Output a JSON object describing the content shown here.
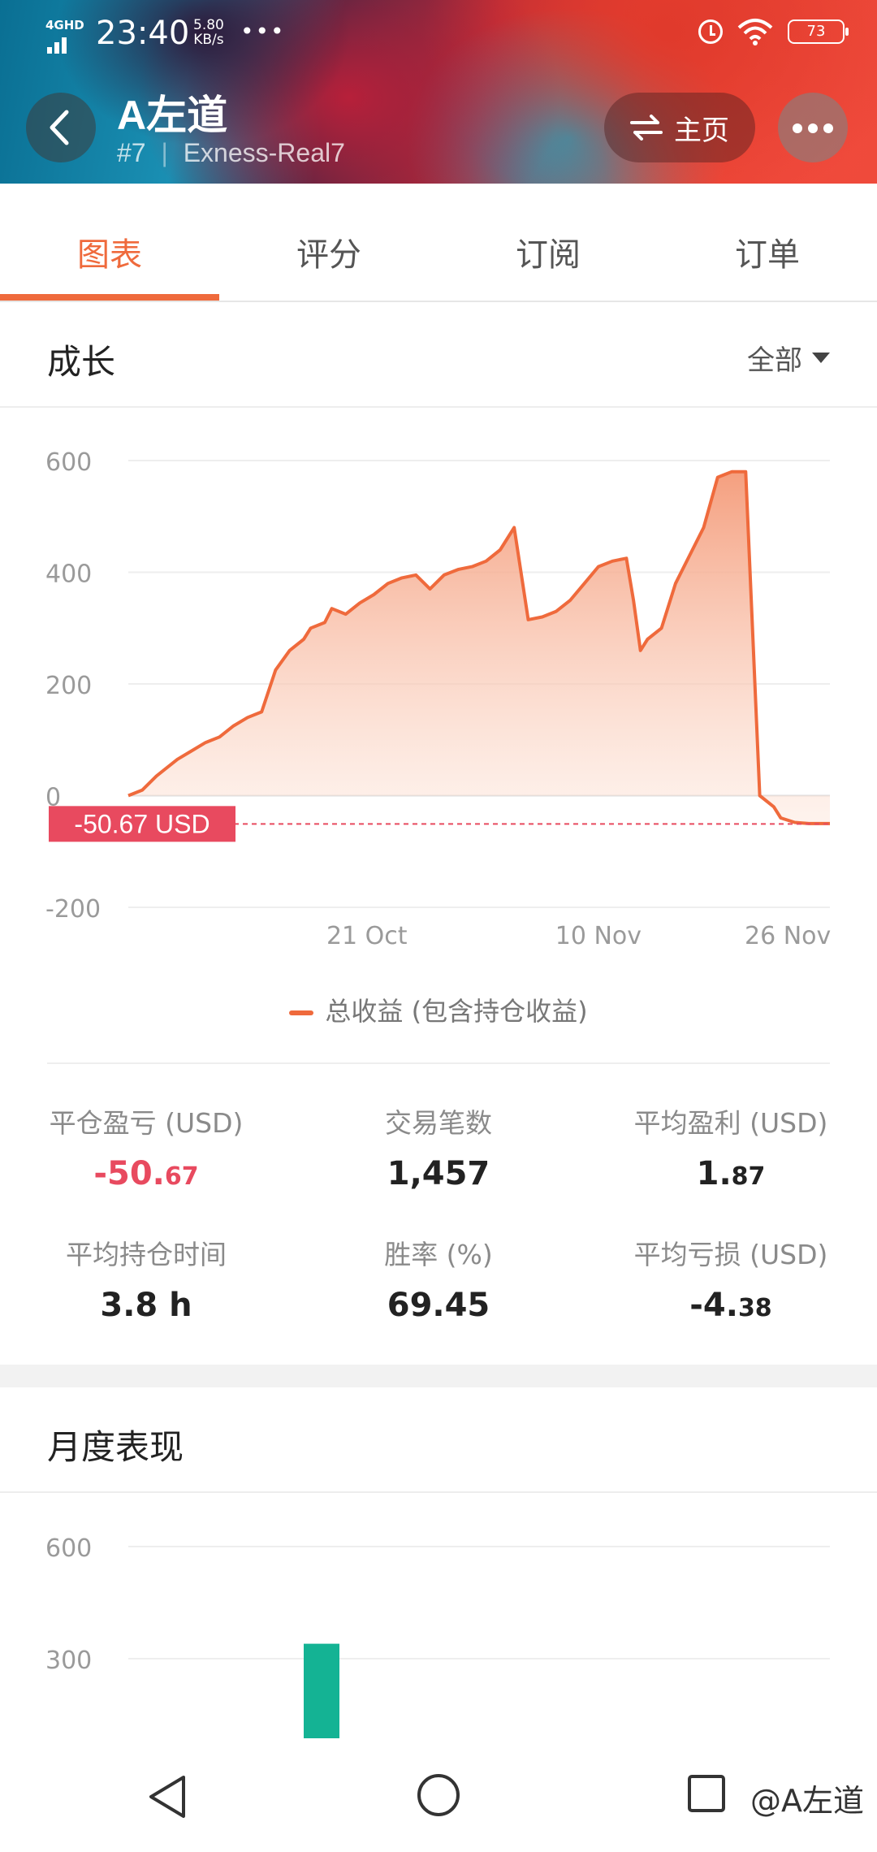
{
  "status_bar": {
    "network": "4GHD",
    "time": "23:40",
    "speed_value": "5.80",
    "speed_unit": "KB/s",
    "more": "•••",
    "battery": "73"
  },
  "header": {
    "account_name": "A左道",
    "rank": "#7",
    "server": "Exness-Real7",
    "home_label": "主页"
  },
  "tabs": [
    {
      "label": "图表",
      "active": true
    },
    {
      "label": "评分",
      "active": false
    },
    {
      "label": "订阅",
      "active": false
    },
    {
      "label": "订单",
      "active": false
    }
  ],
  "growth": {
    "title": "成长",
    "range_label": "全部",
    "current_label": "-50.67 USD",
    "legend": "总收益 (包含持仓收益)"
  },
  "stats": [
    {
      "label": "平仓盈亏 (USD)",
      "value_main": "-50.",
      "value_small": "67",
      "negative": true
    },
    {
      "label": "交易笔数",
      "value_main": "1,457",
      "value_small": "",
      "negative": false
    },
    {
      "label": "平均盈利 (USD)",
      "value_main": "1.",
      "value_small": "87",
      "negative": false
    },
    {
      "label": "平均持仓时间",
      "value_main": "3.8 h",
      "value_small": "",
      "negative": false
    },
    {
      "label": "胜率 (%)",
      "value_main": "69.45",
      "value_small": "",
      "negative": false
    },
    {
      "label": "平均亏损 (USD)",
      "value_main": "-4.",
      "value_small": "38",
      "negative": false
    }
  ],
  "monthly": {
    "title": "月度表现"
  },
  "watermark": "@A左道",
  "colors": {
    "accent": "#ef6a3c",
    "negative": "#e84a5f",
    "bar": "#14b394"
  },
  "chart_data": [
    {
      "type": "area",
      "yticks": [
        600,
        400,
        200,
        0,
        -200
      ],
      "ylim": [
        -200,
        600
      ],
      "xlabels": [
        {
          "x": 0.34,
          "label": "21 Oct"
        },
        {
          "x": 0.67,
          "label": "10 Nov"
        },
        {
          "x": 0.94,
          "label": "26 Nov"
        }
      ],
      "x": [
        0.0,
        0.02,
        0.04,
        0.05,
        0.07,
        0.09,
        0.11,
        0.13,
        0.15,
        0.17,
        0.19,
        0.21,
        0.23,
        0.25,
        0.26,
        0.28,
        0.29,
        0.31,
        0.33,
        0.35,
        0.37,
        0.39,
        0.41,
        0.43,
        0.45,
        0.47,
        0.49,
        0.51,
        0.53,
        0.55,
        0.57,
        0.59,
        0.61,
        0.63,
        0.65,
        0.67,
        0.69,
        0.71,
        0.72,
        0.73,
        0.74,
        0.76,
        0.78,
        0.8,
        0.82,
        0.84,
        0.86,
        0.87,
        0.88,
        0.9,
        0.92,
        0.93,
        0.95,
        0.97,
        0.985,
        1.0
      ],
      "y": [
        0,
        10,
        35,
        45,
        65,
        80,
        95,
        105,
        125,
        140,
        150,
        225,
        260,
        280,
        300,
        310,
        335,
        325,
        345,
        360,
        380,
        390,
        395,
        370,
        395,
        405,
        410,
        420,
        440,
        480,
        315,
        320,
        330,
        350,
        380,
        410,
        420,
        425,
        350,
        260,
        280,
        300,
        380,
        430,
        480,
        570,
        580,
        580,
        580,
        0,
        -20,
        -40,
        -48,
        -50,
        -50,
        -50
      ],
      "current_value": -50.67,
      "series": [
        {
          "name": "总收益 (包含持仓收益)"
        }
      ]
    },
    {
      "type": "bar",
      "yticks": [
        600,
        300
      ],
      "ylim": [
        0,
        600
      ],
      "values": [
        340
      ],
      "bar_x": [
        0.25
      ]
    }
  ]
}
